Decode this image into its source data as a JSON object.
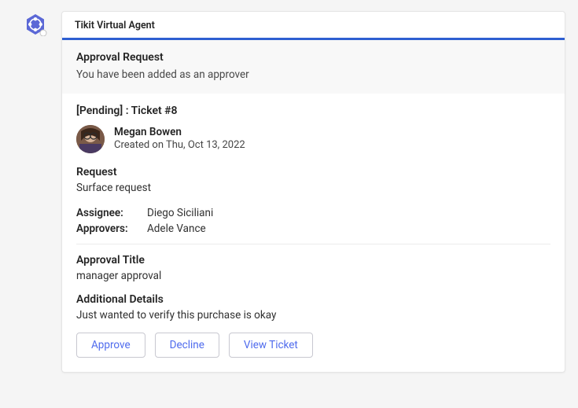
{
  "card": {
    "app_name": "Tikit Virtual Agent",
    "header_title": "Approval Request",
    "header_subtitle": "You have been added as an approver",
    "status_line": "[Pending] : Ticket #8",
    "requester": {
      "name": "Megan Bowen",
      "created_label": "Created on Thu, Oct 13, 2022"
    },
    "request": {
      "label": "Request",
      "text": "Surface request"
    },
    "assignee": {
      "label": "Assignee:",
      "value": "Diego Siciliani"
    },
    "approvers": {
      "label": "Approvers:",
      "value": "Adele Vance"
    },
    "approval_title": {
      "label": "Approval Title",
      "text": "manager approval"
    },
    "additional_details": {
      "label": "Additional Details",
      "text": "Just wanted to verify this purchase is okay"
    },
    "buttons": {
      "approve": "Approve",
      "decline": "Decline",
      "view": "View Ticket"
    }
  }
}
